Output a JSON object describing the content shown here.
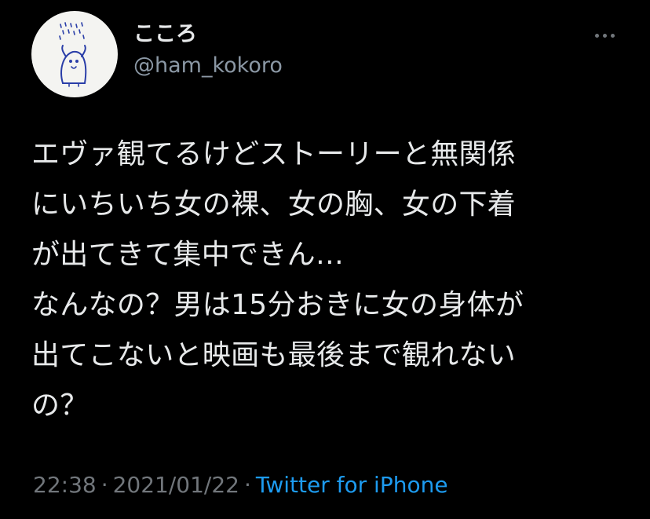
{
  "user": {
    "display_name": "こころ",
    "handle": "@ham_kokoro",
    "avatar_icon": "hamster-doodle-avatar"
  },
  "tweet": {
    "text": "エヴァ観てるけどストーリーと無関係\nにいちいち女の裸、女の胸、女の下着\nが出てきて集中できん…\nなんなの？男は15分おきに女の身体が\n出てこないと映画も最後まで観れない\nの？",
    "time": "22:38",
    "date": "2021/01/22",
    "separator": "·",
    "source": "Twitter for iPhone"
  },
  "menu": {
    "icon": "more-options-icon"
  },
  "colors": {
    "background": "#000000",
    "text": "#e7e9ea",
    "secondary": "#71767b",
    "link": "#1d9bf0"
  }
}
